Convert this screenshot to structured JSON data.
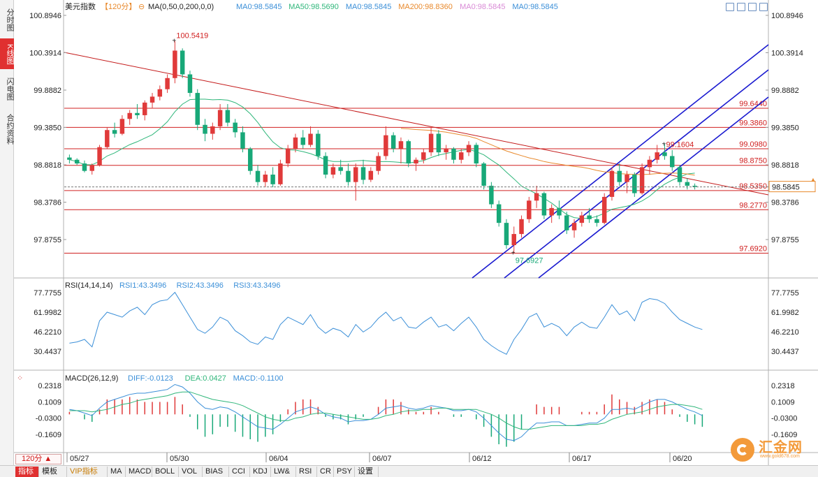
{
  "side_tabs": [
    {
      "label": "分时图",
      "active": false
    },
    {
      "label": "K线图",
      "active": true
    },
    {
      "label": "闪电图",
      "active": false
    },
    {
      "label": "合约资料",
      "active": false
    }
  ],
  "main_header": {
    "symbol": "美元指数",
    "period_tag": "【120分】",
    "ma_params": "MA(0,50,0,200,0,0)",
    "ma_values": [
      {
        "text": "MA0:98.5845",
        "color": "#3b8fd8"
      },
      {
        "text": "MA50:98.5690",
        "color": "#2fb67a"
      },
      {
        "text": "MA0:98.5845",
        "color": "#3b8fd8"
      },
      {
        "text": "MA200:98.8360",
        "color": "#e8892c"
      },
      {
        "text": "MA0:98.5845",
        "color": "#d98ad6"
      },
      {
        "text": "MA0:98.5845",
        "color": "#3b8fd8"
      }
    ]
  },
  "price_axis": {
    "labels": [
      "100.8946",
      "100.3914",
      "99.8882",
      "99.3850",
      "98.8818",
      "98.3786",
      "97.8755"
    ],
    "current": "98.5845"
  },
  "hlines": [
    {
      "label": "99.6440",
      "value": 99.644
    },
    {
      "label": "99.3860",
      "value": 99.386
    },
    {
      "label": "99.0980",
      "value": 99.098
    },
    {
      "label": "98.8750",
      "value": 98.875
    },
    {
      "label": "98.5350",
      "value": 98.535
    },
    {
      "label": "98.2770",
      "value": 98.277
    },
    {
      "label": "97.6920",
      "value": 97.692
    }
  ],
  "annotations": {
    "high": "100.5419",
    "low": "97.6927",
    "recent_high": "99.1604"
  },
  "rsi": {
    "header": "RSI(14,14,14)",
    "values": [
      {
        "text": "RSI1:43.3496",
        "color": "#3b8fd8"
      },
      {
        "text": "RSI2:43.3496",
        "color": "#3b8fd8"
      },
      {
        "text": "RSI3:43.3496",
        "color": "#3b8fd8"
      }
    ],
    "axis": [
      "77.7755",
      "61.9982",
      "46.2210",
      "30.4437"
    ]
  },
  "macd": {
    "header": "MACD(26,12,9)",
    "values": [
      {
        "text": "DIFF:-0.0123",
        "color": "#3b8fd8"
      },
      {
        "text": "DEA:0.0427",
        "color": "#2fb67a"
      },
      {
        "text": "MACD:-0.1100",
        "color": "#3b8fd8"
      }
    ],
    "axis": [
      "0.2318",
      "0.1009",
      "-0.0300",
      "-0.1609"
    ]
  },
  "date_labels": [
    "05/27",
    "05/30",
    "06/04",
    "06/07",
    "06/12",
    "06/17",
    "06/20"
  ],
  "period_selector": "120分 ▲",
  "bottom_tabs": [
    {
      "label": "指标",
      "style": "red"
    },
    {
      "label": "模板",
      "style": ""
    },
    {
      "label": "VIP指标",
      "style": "vip"
    },
    {
      "label": "MA",
      "style": ""
    },
    {
      "label": "MACD",
      "style": ""
    },
    {
      "label": "BOLL",
      "style": ""
    },
    {
      "label": "VOL",
      "style": ""
    },
    {
      "label": "BIAS",
      "style": ""
    },
    {
      "label": "CCI",
      "style": ""
    },
    {
      "label": "KDJ",
      "style": ""
    },
    {
      "label": "LW&",
      "style": ""
    },
    {
      "label": "RSI",
      "style": ""
    },
    {
      "label": "CR",
      "style": ""
    },
    {
      "label": "PSY",
      "style": ""
    },
    {
      "label": "设置",
      "style": ""
    }
  ],
  "toolbar_icons": [
    "move-icon",
    "zoom-in-icon",
    "zoom-out-icon",
    "close-icon"
  ],
  "logo": {
    "text": "汇金网",
    "sub": "www.gold678.com"
  },
  "chart_data": {
    "type": "candlestick",
    "title": "美元指数",
    "ylim": [
      97.5,
      100.9
    ],
    "x_labels": [
      "05/27",
      "05/30",
      "06/04",
      "06/07",
      "06/12",
      "06/17",
      "06/20"
    ],
    "candles": [
      [
        98.98,
        99.02,
        98.9,
        98.95
      ],
      [
        98.95,
        98.97,
        98.88,
        98.9
      ],
      [
        98.9,
        98.94,
        98.78,
        98.8
      ],
      [
        98.8,
        98.9,
        98.75,
        98.88
      ],
      [
        98.88,
        99.15,
        98.86,
        99.12
      ],
      [
        99.12,
        99.38,
        99.1,
        99.35
      ],
      [
        99.35,
        99.45,
        99.25,
        99.3
      ],
      [
        99.3,
        99.55,
        99.28,
        99.5
      ],
      [
        99.5,
        99.62,
        99.42,
        99.58
      ],
      [
        99.58,
        99.7,
        99.5,
        99.55
      ],
      [
        99.55,
        99.75,
        99.48,
        99.72
      ],
      [
        99.72,
        99.85,
        99.65,
        99.8
      ],
      [
        99.8,
        99.95,
        99.75,
        99.9
      ],
      [
        99.9,
        100.1,
        99.85,
        100.05
      ],
      [
        100.05,
        100.55,
        99.98,
        100.42
      ],
      [
        100.42,
        100.45,
        100.05,
        100.1
      ],
      [
        100.1,
        100.15,
        99.8,
        99.85
      ],
      [
        99.85,
        99.9,
        99.35,
        99.42
      ],
      [
        99.42,
        99.5,
        99.2,
        99.3
      ],
      [
        99.3,
        99.45,
        99.22,
        99.4
      ],
      [
        99.4,
        99.7,
        99.35,
        99.62
      ],
      [
        99.62,
        99.7,
        99.4,
        99.45
      ],
      [
        99.45,
        99.5,
        99.25,
        99.32
      ],
      [
        99.32,
        99.4,
        99.05,
        99.1
      ],
      [
        99.1,
        99.12,
        98.75,
        98.8
      ],
      [
        98.8,
        98.88,
        98.6,
        98.65
      ],
      [
        98.65,
        98.8,
        98.58,
        98.75
      ],
      [
        98.75,
        98.85,
        98.58,
        98.62
      ],
      [
        98.62,
        98.95,
        98.6,
        98.9
      ],
      [
        98.9,
        99.15,
        98.85,
        99.1
      ],
      [
        99.1,
        99.3,
        99.05,
        99.25
      ],
      [
        99.25,
        99.35,
        99.1,
        99.15
      ],
      [
        99.15,
        99.4,
        99.12,
        99.3
      ],
      [
        99.3,
        99.35,
        98.95,
        99.0
      ],
      [
        99.0,
        99.05,
        98.7,
        98.75
      ],
      [
        98.75,
        98.9,
        98.7,
        98.85
      ],
      [
        98.85,
        98.95,
        98.75,
        98.8
      ],
      [
        98.8,
        98.9,
        98.6,
        98.65
      ],
      [
        98.65,
        98.9,
        98.4,
        98.85
      ],
      [
        98.85,
        98.95,
        98.62,
        98.68
      ],
      [
        98.68,
        98.85,
        98.65,
        98.8
      ],
      [
        98.8,
        99.05,
        98.75,
        99.0
      ],
      [
        99.0,
        99.4,
        98.95,
        99.28
      ],
      [
        99.28,
        99.32,
        99.05,
        99.1
      ],
      [
        99.1,
        99.25,
        98.9,
        99.2
      ],
      [
        99.2,
        99.22,
        98.85,
        98.9
      ],
      [
        98.9,
        98.98,
        98.8,
        98.95
      ],
      [
        98.95,
        99.1,
        98.9,
        99.05
      ],
      [
        99.05,
        99.38,
        99.0,
        99.3
      ],
      [
        99.3,
        99.35,
        99.0,
        99.05
      ],
      [
        99.05,
        99.15,
        98.95,
        99.1
      ],
      [
        99.1,
        99.12,
        98.9,
        98.95
      ],
      [
        98.95,
        99.1,
        98.9,
        99.05
      ],
      [
        99.05,
        99.2,
        99.0,
        99.15
      ],
      [
        99.15,
        99.18,
        98.85,
        98.9
      ],
      [
        98.9,
        98.92,
        98.55,
        98.6
      ],
      [
        98.6,
        98.65,
        98.3,
        98.35
      ],
      [
        98.35,
        98.4,
        98.05,
        98.1
      ],
      [
        98.1,
        98.15,
        97.75,
        97.8
      ],
      [
        97.8,
        98.05,
        97.69,
        97.95
      ],
      [
        97.95,
        98.2,
        97.9,
        98.15
      ],
      [
        98.15,
        98.45,
        98.1,
        98.4
      ],
      [
        98.4,
        98.6,
        98.3,
        98.5
      ],
      [
        98.5,
        98.52,
        98.15,
        98.2
      ],
      [
        98.2,
        98.35,
        98.1,
        98.3
      ],
      [
        98.3,
        98.4,
        98.15,
        98.2
      ],
      [
        98.2,
        98.25,
        97.95,
        98.0
      ],
      [
        98.0,
        98.15,
        97.9,
        98.1
      ],
      [
        98.1,
        98.25,
        98.05,
        98.2
      ],
      [
        98.2,
        98.3,
        98.1,
        98.15
      ],
      [
        98.15,
        98.2,
        98.05,
        98.1
      ],
      [
        98.1,
        98.5,
        98.08,
        98.45
      ],
      [
        98.45,
        98.85,
        98.4,
        98.8
      ],
      [
        98.8,
        98.9,
        98.6,
        98.65
      ],
      [
        98.65,
        98.8,
        98.5,
        98.75
      ],
      [
        98.75,
        98.78,
        98.45,
        98.5
      ],
      [
        98.5,
        98.9,
        98.48,
        98.85
      ],
      [
        98.85,
        99.0,
        98.75,
        98.95
      ],
      [
        98.95,
        99.15,
        98.9,
        99.05
      ],
      [
        99.05,
        99.16,
        98.95,
        99.0
      ],
      [
        99.0,
        99.08,
        98.8,
        98.85
      ],
      [
        98.85,
        98.88,
        98.6,
        98.65
      ],
      [
        98.65,
        98.7,
        98.55,
        98.6
      ],
      [
        98.6,
        98.63,
        98.55,
        98.585
      ]
    ],
    "rsi_series": [
      37,
      38,
      40,
      34,
      55,
      62,
      60,
      58,
      63,
      66,
      60,
      68,
      71,
      72,
      78,
      68,
      58,
      48,
      45,
      50,
      58,
      55,
      47,
      43,
      38,
      36,
      42,
      40,
      52,
      58,
      55,
      52,
      60,
      50,
      45,
      49,
      47,
      42,
      52,
      46,
      50,
      57,
      62,
      55,
      58,
      50,
      49,
      54,
      58,
      50,
      52,
      47,
      53,
      58,
      50,
      40,
      35,
      31,
      28,
      40,
      48,
      58,
      61,
      50,
      53,
      50,
      43,
      50,
      54,
      50,
      49,
      58,
      68,
      60,
      63,
      55,
      70,
      73,
      72,
      69,
      62,
      56,
      53,
      50,
      48
    ],
    "macd_diff": [
      0.04,
      0.03,
      0.01,
      -0.01,
      0.05,
      0.1,
      0.12,
      0.14,
      0.16,
      0.17,
      0.17,
      0.18,
      0.19,
      0.2,
      0.24,
      0.22,
      0.17,
      0.1,
      0.05,
      0.04,
      0.06,
      0.05,
      0.02,
      -0.02,
      -0.06,
      -0.1,
      -0.11,
      -0.12,
      -0.08,
      -0.03,
      0.02,
      0.04,
      0.06,
      0.04,
      0.0,
      -0.02,
      -0.03,
      -0.06,
      -0.05,
      -0.05,
      -0.04,
      0.0,
      0.05,
      0.06,
      0.07,
      0.05,
      0.04,
      0.05,
      0.07,
      0.06,
      0.05,
      0.03,
      0.03,
      0.04,
      0.02,
      -0.03,
      -0.09,
      -0.15,
      -0.2,
      -0.21,
      -0.18,
      -0.12,
      -0.07,
      -0.07,
      -0.06,
      -0.06,
      -0.09,
      -0.09,
      -0.08,
      -0.07,
      -0.07,
      -0.03,
      0.04,
      0.04,
      0.05,
      0.04,
      0.07,
      0.1,
      0.12,
      0.12,
      0.1,
      0.07,
      0.04,
      0.02,
      -0.01
    ],
    "macd_dea": [
      0.03,
      0.03,
      0.03,
      0.02,
      0.03,
      0.04,
      0.06,
      0.08,
      0.09,
      0.11,
      0.12,
      0.13,
      0.14,
      0.15,
      0.17,
      0.18,
      0.18,
      0.16,
      0.14,
      0.12,
      0.11,
      0.1,
      0.09,
      0.07,
      0.04,
      0.01,
      -0.02,
      -0.04,
      -0.05,
      -0.05,
      -0.03,
      -0.02,
      0.0,
      0.01,
      0.01,
      0.0,
      -0.01,
      -0.02,
      -0.03,
      -0.04,
      -0.04,
      -0.03,
      -0.01,
      0.0,
      0.02,
      0.03,
      0.03,
      0.04,
      0.04,
      0.05,
      0.05,
      0.04,
      0.04,
      0.04,
      0.04,
      0.02,
      0.0,
      -0.03,
      -0.07,
      -0.1,
      -0.12,
      -0.12,
      -0.11,
      -0.1,
      -0.09,
      -0.09,
      -0.09,
      -0.09,
      -0.09,
      -0.08,
      -0.08,
      -0.07,
      -0.04,
      -0.02,
      0.0,
      0.01,
      0.02,
      0.04,
      0.06,
      0.07,
      0.08,
      0.08,
      0.07,
      0.06,
      0.04
    ]
  }
}
